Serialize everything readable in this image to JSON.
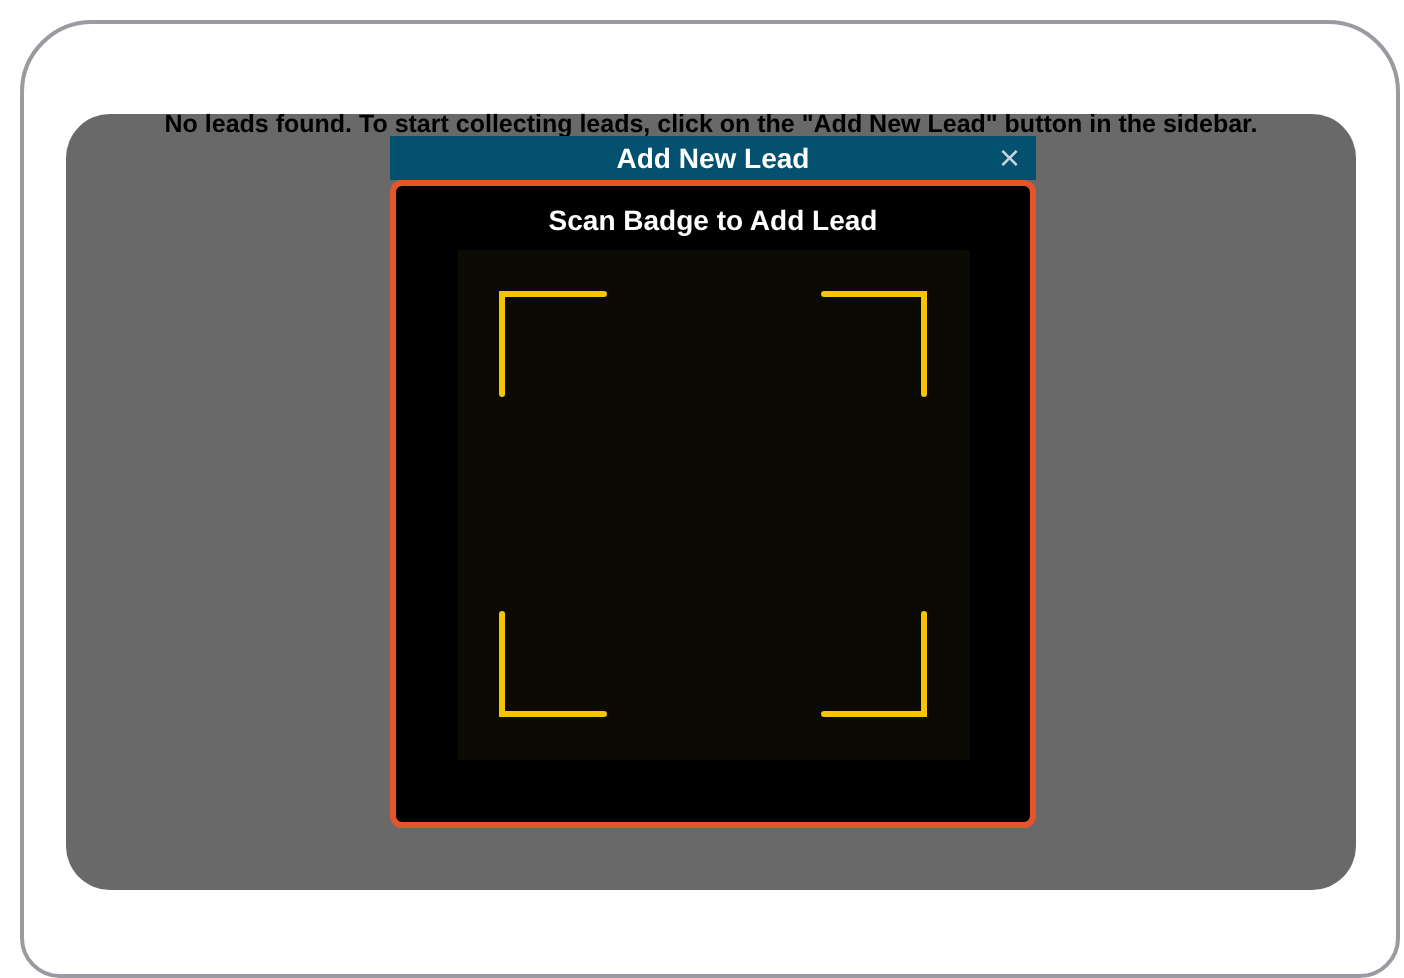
{
  "empty_message": "No leads found. To start collecting leads, click on the \"Add New Lead\" button in the sidebar.",
  "dialog": {
    "title": "Add New Lead",
    "close": "×",
    "heading": "Scan Badge to Add Lead"
  }
}
